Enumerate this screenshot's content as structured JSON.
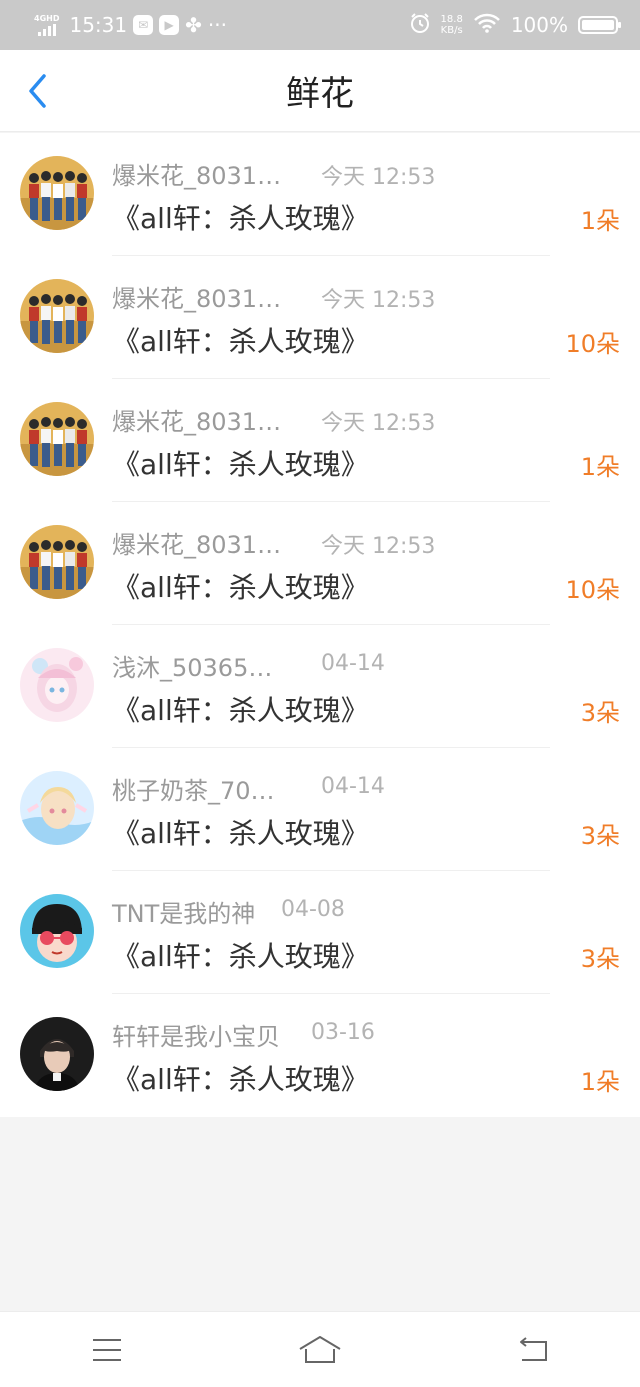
{
  "status_bar": {
    "network_label": "4GHD",
    "time": "15:31",
    "speed_value": "18.8",
    "speed_unit": "KB/s",
    "battery": "100%",
    "dots": "···"
  },
  "header": {
    "title": "鲜花",
    "back_icon": "chevron-left-icon",
    "accent_color": "#2a8cf0"
  },
  "items": [
    {
      "name": "爆米花_8031…",
      "time": "今天 12:53",
      "book": "《all轩：杀人玫瑰》",
      "count": "1朵"
    },
    {
      "name": "爆米花_8031…",
      "time": "今天 12:53",
      "book": "《all轩：杀人玫瑰》",
      "count": "10朵"
    },
    {
      "name": "爆米花_8031…",
      "time": "今天 12:53",
      "book": "《all轩：杀人玫瑰》",
      "count": "1朵"
    },
    {
      "name": "爆米花_8031…",
      "time": "今天 12:53",
      "book": "《all轩：杀人玫瑰》",
      "count": "10朵"
    },
    {
      "name": "浅沐_50365…",
      "time": "04-14",
      "book": "《all轩：杀人玫瑰》",
      "count": "3朵"
    },
    {
      "name": "桃子奶茶_70…",
      "time": "04-14",
      "book": "《all轩：杀人玫瑰》",
      "count": "3朵"
    },
    {
      "name": "TNT是我的神",
      "time": "04-08",
      "book": "《all轩：杀人玫瑰》",
      "count": "3朵"
    },
    {
      "name": "轩轩是我小宝贝",
      "time": "03-16",
      "book": "《all轩：杀人玫瑰》",
      "count": "1朵"
    }
  ],
  "colors": {
    "count": "#f07d28",
    "name": "#9a9a9a",
    "time": "#b3b3b3"
  },
  "nav": {
    "menu_icon": "menu-icon",
    "home_icon": "home-icon",
    "back_icon": "return-icon"
  }
}
